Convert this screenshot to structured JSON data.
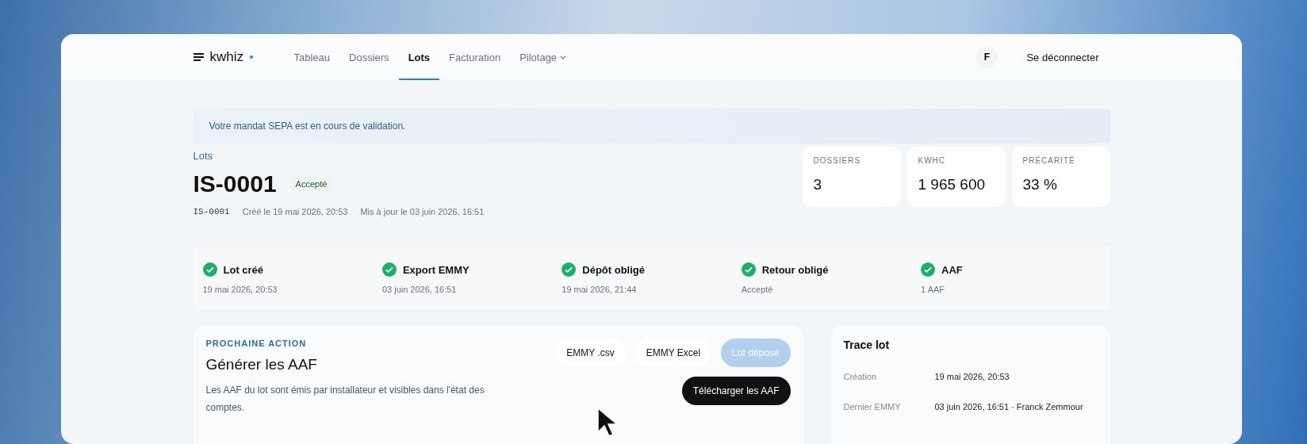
{
  "nav": {
    "brand": "kwhiz",
    "tabs": [
      {
        "label": "Tableau",
        "selected": false,
        "dropdown": false
      },
      {
        "label": "Dossiers",
        "selected": false,
        "dropdown": false
      },
      {
        "label": "Lots",
        "selected": true,
        "dropdown": false
      },
      {
        "label": "Facturation",
        "selected": false,
        "dropdown": false
      },
      {
        "label": "Pilotage",
        "selected": false,
        "dropdown": true
      }
    ],
    "avatar": "F",
    "logout": "Se déconnecter"
  },
  "banner": "Votre mandat SEPA est en cours de validation.",
  "breadcrumb": "Lots",
  "lot": {
    "title": "IS-0001",
    "status": "Accepté",
    "code": "IS-0001",
    "created": "Créé le 19 mai 2026, 20:53",
    "updated": "Mis à jour le 03 juin 2026, 16:51"
  },
  "stats": [
    {
      "label": "DOSSIERS",
      "value": "3"
    },
    {
      "label": "KWHC",
      "value": "1 965 600"
    },
    {
      "label": "PRÉCARITÉ",
      "value": "33 %"
    }
  ],
  "steps": [
    {
      "label": "Lot créé",
      "detail": "19 mai 2026, 20:53",
      "done": true
    },
    {
      "label": "Export EMMY",
      "detail": "03 juin 2026, 16:51",
      "done": true
    },
    {
      "label": "Dépôt obligé",
      "detail": "19 mai 2026, 21:44",
      "done": true
    },
    {
      "label": "Retour obligé",
      "detail": "Accepté",
      "done": true
    },
    {
      "label": "AAF",
      "detail": "1 AAF",
      "done": true
    }
  ],
  "next_action": {
    "eyebrow": "PROCHAINE ACTION",
    "title": "Générer les AAF",
    "description": "Les AAF du lot sont émis par installateur et visibles dans l'état des comptes.",
    "buttons": [
      {
        "label": "EMMY .csv",
        "kind": "ghost",
        "disabled": false
      },
      {
        "label": "EMMY Excel",
        "kind": "ghost",
        "disabled": false
      },
      {
        "label": "Lot déposé",
        "kind": "primary",
        "disabled": true
      },
      {
        "label": "Télécharger les AAF",
        "kind": "dark",
        "disabled": false
      }
    ]
  },
  "trace": {
    "title": "Trace lot",
    "rows": [
      {
        "label": "Création",
        "value": "19 mai 2026, 20:53"
      },
      {
        "label": "Dernier EMMY",
        "value": "03 juin 2026, 16:51 · Franck Zemmour"
      }
    ]
  }
}
